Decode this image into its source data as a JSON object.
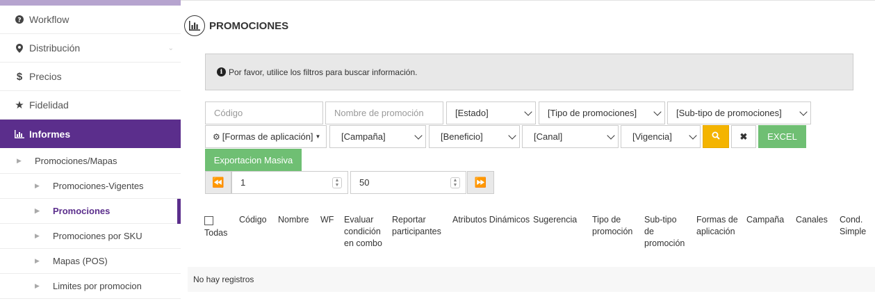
{
  "sidebar": {
    "items": [
      {
        "label": "Workflow",
        "icon": "question-circle-icon"
      },
      {
        "label": "Distribución",
        "icon": "map-marker-icon"
      },
      {
        "label": "Precios",
        "icon": "dollar-icon"
      },
      {
        "label": "Fidelidad",
        "icon": "star-icon"
      },
      {
        "label": "Informes",
        "icon": "bar-chart-icon"
      }
    ],
    "submenu_l1": "Promociones/Mapas",
    "submenu_l2": [
      "Promociones-Vigentes",
      "Promociones",
      "Promociones por SKU",
      "Mapas (POS)",
      "Limites por promocion"
    ]
  },
  "page": {
    "title": "PROMOCIONES",
    "info": "Por favor, utilice los filtros para buscar información."
  },
  "filters": {
    "codigo_placeholder": "Código",
    "nombre_placeholder": "Nombre de promoción",
    "estado": "[Estado]",
    "tipo": "[Tipo de promociones]",
    "subtipo": "[Sub-tipo de promociones]",
    "formas": "[Formas de aplicación]",
    "campana": "[Campaña]",
    "beneficio": "[Beneficio]",
    "canal": "[Canal]",
    "vigencia": "[Vigencia]",
    "excel_label": "EXCEL",
    "export_label": "Exportacion Masiva"
  },
  "pagination": {
    "page": "1",
    "page_size": "50"
  },
  "table": {
    "columns": [
      "Todas",
      "Código",
      "Nombre",
      "WF",
      "Evaluar condición en combo",
      "Reportar participantes",
      "Atributos Dinámicos",
      "Sugerencia",
      "Tipo de promoción",
      "Sub-tipo de promoción",
      "Formas de aplicación",
      "Campaña",
      "Canales",
      "Cond. Simple"
    ],
    "empty": "No hay registros"
  },
  "colors": {
    "accent": "#5b2e8c",
    "excel": "#6fbf73",
    "search": "#f4b400"
  }
}
